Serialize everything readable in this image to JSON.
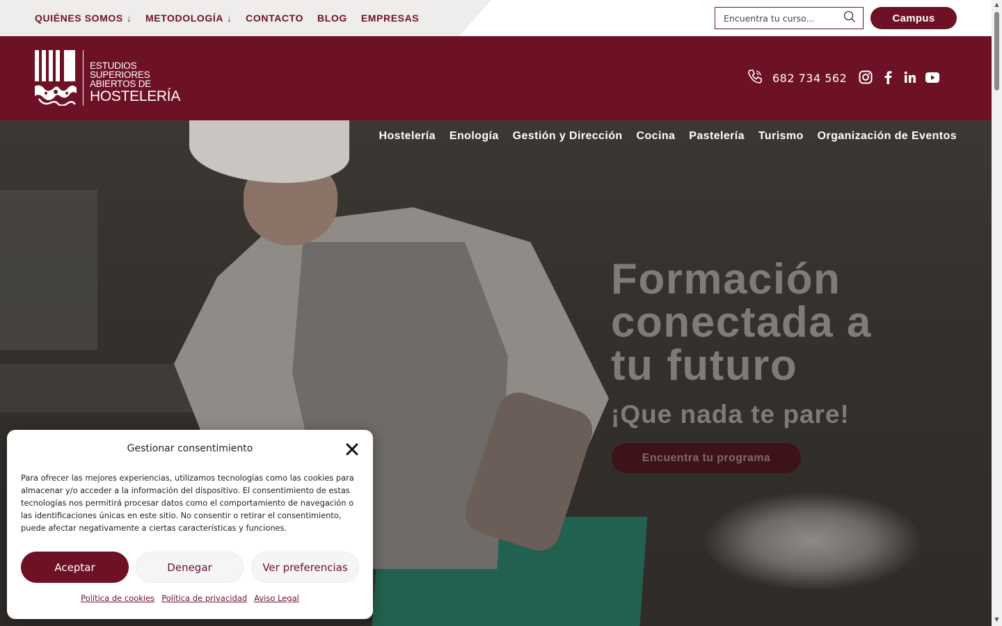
{
  "topnav": {
    "items": [
      {
        "label": "QUIÉNES SOMOS",
        "has_dropdown": true
      },
      {
        "label": "METODOLOGÍA",
        "has_dropdown": true
      },
      {
        "label": "CONTACTO",
        "has_dropdown": false
      },
      {
        "label": "BLOG",
        "has_dropdown": false
      },
      {
        "label": "EMPRESAS",
        "has_dropdown": false
      }
    ],
    "dropdown_arrow": "↓",
    "search_placeholder": "Encuentra tu curso...",
    "campus_label": "Campus"
  },
  "header": {
    "logo_line1": "ESTUDIOS",
    "logo_line2": "SUPERIORES",
    "logo_line3": "ABIERTOS DE",
    "logo_line4": "HOSTELERÍA",
    "phone": "682 734 562",
    "social": [
      "instagram-icon",
      "facebook-icon",
      "linkedin-icon",
      "youtube-icon"
    ]
  },
  "hero": {
    "categories": [
      "Hostelería",
      "Enología",
      "Gestión y Dirección",
      "Cocina",
      "Pastelería",
      "Turismo",
      "Organización de Eventos"
    ],
    "title_line1": "Formación",
    "title_line2": "conectada a",
    "title_line3": "tu futuro",
    "subtitle": "¡Que nada te pare!",
    "cta": "Encuentra tu programa"
  },
  "cookie": {
    "title": "Gestionar consentimiento",
    "text": "Para ofrecer las mejores experiencias, utilizamos tecnologías como las cookies para almacenar y/o acceder a la información del dispositivo. El consentimiento de estas tecnologías nos permitirá procesar datos como el comportamiento de navegación o las identificaciones únicas en este sitio. No consentir o retirar el consentimiento, puede afectar negativamente a ciertas características y funciones.",
    "accept": "Aceptar",
    "deny": "Denegar",
    "preferences": "Ver preferencias",
    "links": [
      "Política de cookies",
      "Política de privacidad",
      "Aviso Legal"
    ]
  },
  "colors": {
    "brand": "#6d1125",
    "topbar_grey": "#efedeb",
    "hero_text": "#7f7b78"
  }
}
